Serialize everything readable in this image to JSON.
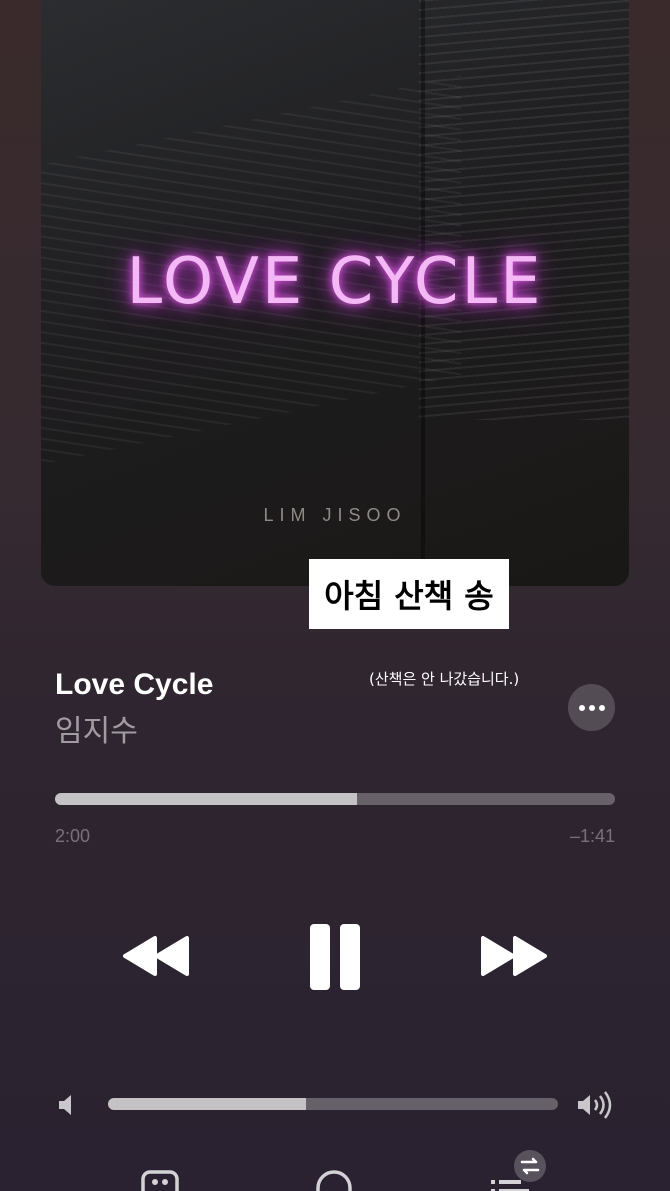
{
  "album": {
    "title": "LOVE CYCLE",
    "artist": "LIM JISOO"
  },
  "overlay": {
    "caption": "아침 산책 송",
    "note": "(산책은 안 나갔습니다.)"
  },
  "track": {
    "title": "Love Cycle",
    "artist": "임지수",
    "more_label": "•••"
  },
  "playback": {
    "elapsed": "2:00",
    "remaining": "–1:41",
    "progress_fraction": 0.54,
    "state": "playing"
  },
  "volume": {
    "level_fraction": 0.44
  },
  "icons": {
    "rewind": "rewind-icon",
    "pause": "pause-icon",
    "forward": "fast-forward-icon",
    "volume_low": "speaker-low-icon",
    "volume_high": "speaker-high-icon",
    "lyrics": "lyrics-quote-icon",
    "airplay": "airplay-icon",
    "queue": "queue-list-icon",
    "repeat": "repeat-icon"
  },
  "colors": {
    "neon": "#f3b8f5",
    "background": "#342a30",
    "track_fill": "#a59ea4"
  }
}
